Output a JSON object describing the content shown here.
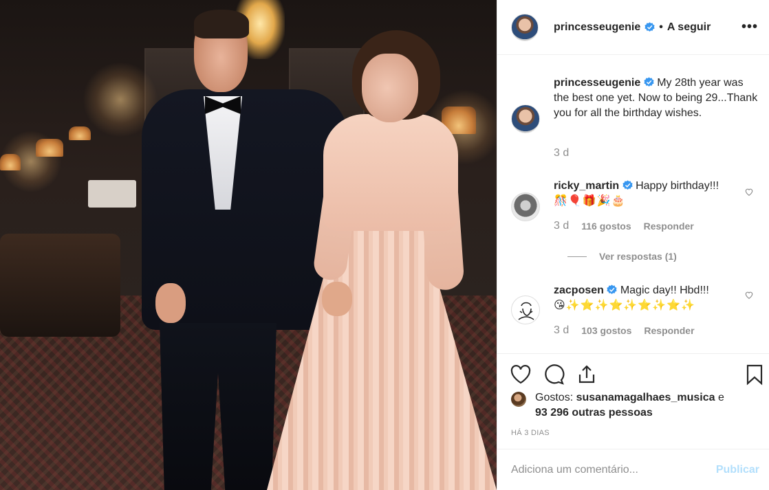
{
  "post": {
    "author": "princesseugenie",
    "separator": "•",
    "follow_label": "A seguir",
    "more_label": "•••"
  },
  "comments": [
    {
      "user": "princesseugenie",
      "verified": true,
      "text": "My 28th year was the best one yet. Now to being 29...Thank you for all the birthday wishes.",
      "age": "3 d"
    },
    {
      "user": "ricky_martin",
      "verified": true,
      "text": "Happy birthday!!!",
      "emojis": "🎊🎈🎁🎉🎂",
      "age": "3 d",
      "likes": "116 gostos",
      "reply_label": "Responder",
      "view_replies": "Ver respostas (1)"
    },
    {
      "user": "zacposen",
      "verified": true,
      "text": "Magic day!! Hbd!!!",
      "emojis": "😘✨⭐✨⭐✨⭐✨⭐✨",
      "age": "3 d",
      "likes": "103 gostos",
      "reply_label": "Responder"
    }
  ],
  "likes": {
    "prefix": "Gostos:",
    "first_user": "susanamagalhaes_musica",
    "connector": "e",
    "others": "93 296 outras pessoas"
  },
  "date_label": "HÁ 3 DIAS",
  "add_comment": {
    "placeholder": "Adiciona um comentário...",
    "publish_label": "Publicar"
  },
  "colors": {
    "text": "#262626",
    "muted": "#8e8e8e",
    "verified": "#3897f0",
    "publish_disabled": "#b2dffc"
  }
}
